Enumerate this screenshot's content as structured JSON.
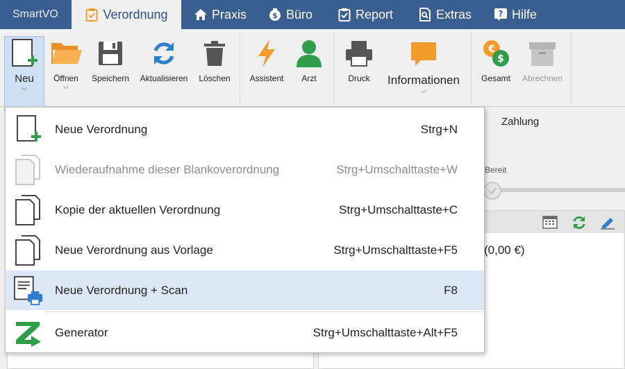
{
  "tabs": {
    "app": "SmartVO",
    "items": [
      {
        "label": "Verordnung",
        "icon": "clipboard-check-icon"
      },
      {
        "label": "Praxis",
        "icon": "home-icon"
      },
      {
        "label": "Büro",
        "icon": "money-bag-icon"
      },
      {
        "label": "Report",
        "icon": "clipboard-icon"
      },
      {
        "label": "Extras",
        "icon": "document-search-icon"
      },
      {
        "label": "Hilfe",
        "icon": "help-icon"
      }
    ]
  },
  "ribbon": {
    "buttons": [
      {
        "label": "Neu"
      },
      {
        "label": "Öffnen"
      },
      {
        "label": "Speichern"
      },
      {
        "label": "Aktualisieren"
      },
      {
        "label": "Löschen"
      },
      {
        "label": "Assistent"
      },
      {
        "label": "Arzt"
      },
      {
        "label": "Druck"
      },
      {
        "label": "Informationen"
      },
      {
        "label": "Gesamt"
      },
      {
        "label": "Abrechnen"
      }
    ],
    "group_label": "Zahlung"
  },
  "background": {
    "status_label": "Bereit",
    "amount": "(0,00 €)"
  },
  "menu": {
    "items": [
      {
        "label": "Neue Verordnung",
        "shortcut": "Strg+N",
        "enabled": true
      },
      {
        "label": "Wiederaufnahme dieser Blankoverordnung",
        "shortcut": "Strg+Umschalttaste+W",
        "enabled": false
      },
      {
        "label": "Kopie der aktuellen Verordnung",
        "shortcut": "Strg+Umschalttaste+C",
        "enabled": true
      },
      {
        "label": "Neue Verordnung aus Vorlage",
        "shortcut": "Strg+Umschalttaste+F5",
        "enabled": true
      },
      {
        "label": "Neue Verordnung + Scan",
        "shortcut": "F8",
        "enabled": true,
        "highlighted": true
      },
      {
        "label": "Generator",
        "shortcut": "Strg+Umschalttaste+Alt+F5",
        "enabled": true
      }
    ]
  },
  "colors": {
    "tabbar": "#3b5e91",
    "accent_green": "#2e9e4a",
    "accent_orange": "#f39c2d",
    "accent_blue": "#2f7fd1",
    "highlight": "#dde8f7"
  }
}
